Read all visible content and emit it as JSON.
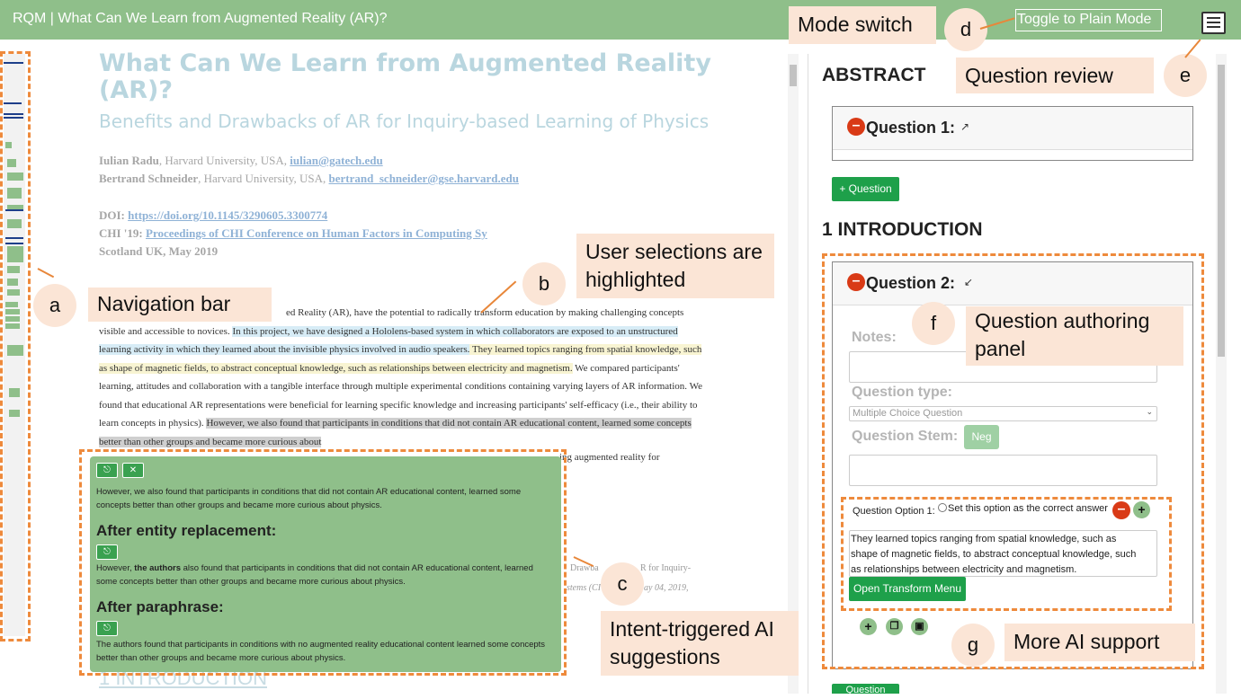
{
  "header": {
    "title": "RQM | What Can We Learn from Augmented Reality (AR)?",
    "toggle_label": "Toggle to Plain Mode",
    "review_icon": "list-icon"
  },
  "document": {
    "title": "What Can We Learn from Augmented Reality (AR)?",
    "subtitle": "Benefits and Drawbacks of AR for Inquiry-based Learning of Physics",
    "authors": [
      {
        "name": "Iulian Radu",
        "affil": ", Harvard University, USA, ",
        "email": "iulian@gatech.edu"
      },
      {
        "name": "Bertrand Schneider",
        "affil": ", Harvard University, USA, ",
        "email": "bertrand_schneider@gse.harvard.edu"
      }
    ],
    "doi_label": "DOI: ",
    "doi": "https://doi.org/10.1145/3290605.3300774",
    "venue_label": "CHI '19: ",
    "venue": "Proceedings of CHI Conference on Human Factors in Computing Sy",
    "location": "Scotland UK, May 2019",
    "abstract": {
      "p0": "ed Reality (AR), have the potential to radically transform education by making challenging concepts visible and accessible to novices. ",
      "p1": "In this project, we have designed a Hololens-based system in which collaborators are exposed to an unstructured learning activity in which they learned about the invisible physics involved in audio speakers.",
      "p2": " They learned topics ranging from spatial knowledge, such as shape of magnetic fields, to abstract conceptual knowledge, such as relationships between electricity and magnetism.",
      "p3": " We compared participants' learning, attitudes and collaboration with a tangible interface through multiple experimental conditions containing varying layers of AR information. We found that educational AR representations were beneficial for learning specific knowledge and increasing participants' self-efficacy (i.e., their ability to learn concepts in physics). ",
      "p4": "However, we also found that participants in conditions that did not contain AR educational content, learned some concepts better than other groups and became more curious about",
      "p5": "ing augmented reality for"
    },
    "ref_line1": "Drawba",
    "ref_line1b": "R for Inquiry-",
    "ref_line2": "stems (CI",
    "ref_line2b": "ay 04, 2019,",
    "intro_heading": "1 INTRODUCTION"
  },
  "suggestions": {
    "original": "However, we also found that participants in conditions that did not contain AR educational content, learned some concepts better than other groups and became more curious about physics.",
    "entity_heading": "After entity replacement:",
    "entity_pre": "However, ",
    "entity_bold": "the authors",
    "entity_post": " also found that participants in conditions that did not contain AR educational content, learned some concepts better than other groups and became more curious about physics.",
    "paraphrase_heading": "After paraphrase:",
    "paraphrase": "The authors found that participants in conditions with no augmented reality educational content learned some concepts better than other groups and became more curious about physics."
  },
  "panel": {
    "abstract_heading": "ABSTRACT",
    "q1_title": "Question 1:",
    "add_question": "+ Question",
    "intro_heading": "1 INTRODUCTION",
    "q2_title": "Question 2:",
    "notes_label": "Notes:",
    "type_label": "Question type:",
    "type_value": "Multiple Choice Question",
    "stem_label": "Question Stem:",
    "neg_label": "Neg",
    "option_label": "Question Option 1:",
    "correct_label": "Set this option as the correct answer",
    "option_text": "They learned topics ranging from spatial knowledge, such as shape of magnetic fields, to abstract conceptual knowledge, such as relationships between electricity and magnetism.",
    "transform_label": "Open Transform Menu",
    "bottom_button": "Question"
  },
  "annotations": {
    "a_letter": "a",
    "a_label": "Navigation bar",
    "b_letter": "b",
    "b_label": "User selections are highlighted",
    "c_letter": "c",
    "c_label": "Intent-triggered AI suggestions",
    "d_letter": "d",
    "d_label": "Mode switch",
    "e_letter": "e",
    "e_label": "Question review",
    "f_letter": "f",
    "f_label": "Question authoring panel",
    "g_letter": "g",
    "g_label": "More AI support"
  },
  "colors": {
    "header_green": "#8fbf8a",
    "accent_orange": "#ee8a3c",
    "button_green": "#1ea04a",
    "minus_red": "#d93a16"
  }
}
